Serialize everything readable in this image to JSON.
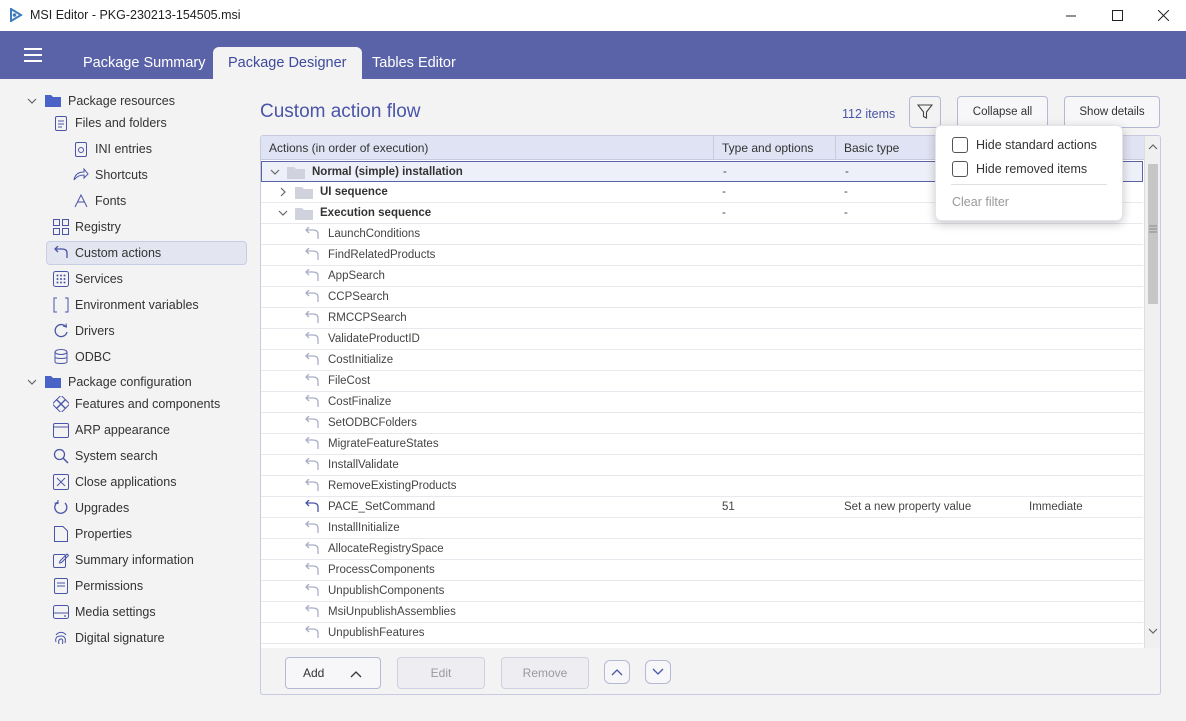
{
  "window": {
    "title": "MSI Editor - PKG-230213-154505.msi",
    "minimize_glyph": "—",
    "maximize_glyph": "☐",
    "close_glyph": "✕"
  },
  "tabs": [
    {
      "label": "Package Summary"
    },
    {
      "label": "Package Designer"
    },
    {
      "label": "Tables Editor"
    }
  ],
  "sidebar": {
    "group_resources": "Package resources",
    "files_and_folders": "Files and folders",
    "ini_entries": "INI entries",
    "shortcuts": "Shortcuts",
    "fonts": "Fonts",
    "registry": "Registry",
    "custom_actions": "Custom actions",
    "services": "Services",
    "environment_variables": "Environment variables",
    "drivers": "Drivers",
    "odbc": "ODBC",
    "group_configuration": "Package configuration",
    "features_and_components": "Features and components",
    "arp_appearance": "ARP appearance",
    "system_search": "System search",
    "close_applications": "Close applications",
    "upgrades": "Upgrades",
    "properties": "Properties",
    "summary_information": "Summary information",
    "permissions": "Permissions",
    "media_settings": "Media settings",
    "digital_signature": "Digital signature"
  },
  "content": {
    "title": "Custom action flow",
    "item_count": "112 items",
    "collapse_all": "Collapse all",
    "show_details": "Show details"
  },
  "grid": {
    "columns": [
      "Actions (in order of execution)",
      "Type and options",
      "Basic type"
    ],
    "groups": {
      "normal": {
        "name": "Normal (simple) installation",
        "type": "-",
        "basic": "-"
      },
      "ui": {
        "name": "UI sequence",
        "type": "-",
        "basic": "-"
      },
      "exec": {
        "name": "Execution sequence",
        "type": "-",
        "basic": "-"
      }
    },
    "actions": [
      {
        "name": "LaunchConditions"
      },
      {
        "name": "FindRelatedProducts"
      },
      {
        "name": "AppSearch"
      },
      {
        "name": "CCPSearch"
      },
      {
        "name": "RMCCPSearch"
      },
      {
        "name": "ValidateProductID"
      },
      {
        "name": "CostInitialize"
      },
      {
        "name": "FileCost"
      },
      {
        "name": "CostFinalize"
      },
      {
        "name": "SetODBCFolders"
      },
      {
        "name": "MigrateFeatureStates"
      },
      {
        "name": "InstallValidate"
      },
      {
        "name": "RemoveExistingProducts"
      },
      {
        "name": "PACE_SetCommand",
        "type": "51",
        "basic": "Set a new property value",
        "exec": "Immediate"
      },
      {
        "name": "InstallInitialize"
      },
      {
        "name": "AllocateRegistrySpace"
      },
      {
        "name": "ProcessComponents"
      },
      {
        "name": "UnpublishComponents"
      },
      {
        "name": "MsiUnpublishAssemblies"
      },
      {
        "name": "UnpublishFeatures"
      }
    ]
  },
  "bottom": {
    "add": "Add",
    "edit": "Edit",
    "remove": "Remove"
  },
  "filter_popup": {
    "hide_standard": "Hide standard actions",
    "hide_removed": "Hide removed items",
    "clear_filter": "Clear filter"
  },
  "colors": {
    "accent": "#5b63a8",
    "title_blue": "#4a55a8"
  }
}
